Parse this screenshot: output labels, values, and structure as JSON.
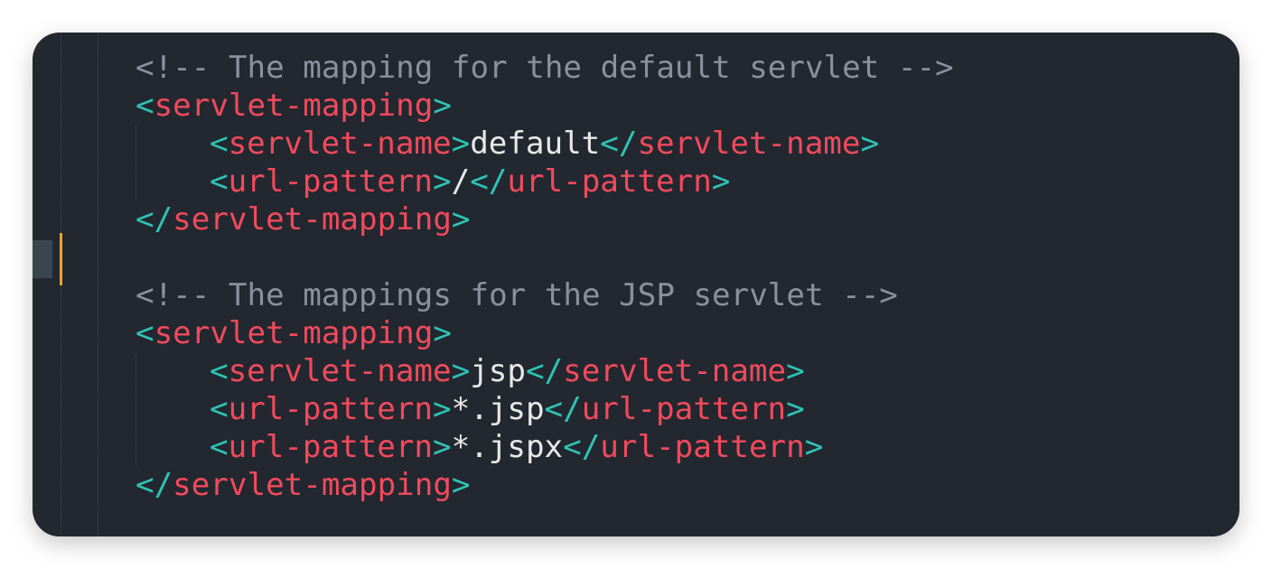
{
  "editor": {
    "colors": {
      "background": "#232830",
      "comment": "#8a919c",
      "bracket": "#2ec4b6",
      "tag": "#f24a5c",
      "text": "#e8e8e8",
      "change_marker": "#f0a030"
    },
    "lines": [
      {
        "indent": 0,
        "tokens": [
          {
            "k": "c",
            "v": "<!-- The mapping for the default servlet -->"
          }
        ]
      },
      {
        "indent": 0,
        "tokens": [
          {
            "k": "p",
            "v": "<"
          },
          {
            "k": "t",
            "v": "servlet-mapping"
          },
          {
            "k": "p",
            "v": ">"
          }
        ]
      },
      {
        "indent": 1,
        "tokens": [
          {
            "k": "p",
            "v": "<"
          },
          {
            "k": "t",
            "v": "servlet-name"
          },
          {
            "k": "p",
            "v": ">"
          },
          {
            "k": "x",
            "v": "default"
          },
          {
            "k": "p",
            "v": "</"
          },
          {
            "k": "t",
            "v": "servlet-name"
          },
          {
            "k": "p",
            "v": ">"
          }
        ]
      },
      {
        "indent": 1,
        "tokens": [
          {
            "k": "p",
            "v": "<"
          },
          {
            "k": "t",
            "v": "url-pattern"
          },
          {
            "k": "p",
            "v": ">"
          },
          {
            "k": "x",
            "v": "/"
          },
          {
            "k": "p",
            "v": "</"
          },
          {
            "k": "t",
            "v": "url-pattern"
          },
          {
            "k": "p",
            "v": ">"
          }
        ]
      },
      {
        "indent": 0,
        "tokens": [
          {
            "k": "p",
            "v": "</"
          },
          {
            "k": "t",
            "v": "servlet-mapping"
          },
          {
            "k": "p",
            "v": ">"
          }
        ]
      },
      {
        "indent": 0,
        "tokens": []
      },
      {
        "indent": 0,
        "tokens": [
          {
            "k": "c",
            "v": "<!-- The mappings for the JSP servlet -->"
          }
        ]
      },
      {
        "indent": 0,
        "tokens": [
          {
            "k": "p",
            "v": "<"
          },
          {
            "k": "t",
            "v": "servlet-mapping"
          },
          {
            "k": "p",
            "v": ">"
          }
        ]
      },
      {
        "indent": 1,
        "tokens": [
          {
            "k": "p",
            "v": "<"
          },
          {
            "k": "t",
            "v": "servlet-name"
          },
          {
            "k": "p",
            "v": ">"
          },
          {
            "k": "x",
            "v": "jsp"
          },
          {
            "k": "p",
            "v": "</"
          },
          {
            "k": "t",
            "v": "servlet-name"
          },
          {
            "k": "p",
            "v": ">"
          }
        ]
      },
      {
        "indent": 1,
        "tokens": [
          {
            "k": "p",
            "v": "<"
          },
          {
            "k": "t",
            "v": "url-pattern"
          },
          {
            "k": "p",
            "v": ">"
          },
          {
            "k": "x",
            "v": "*.jsp"
          },
          {
            "k": "p",
            "v": "</"
          },
          {
            "k": "t",
            "v": "url-pattern"
          },
          {
            "k": "p",
            "v": ">"
          }
        ]
      },
      {
        "indent": 1,
        "tokens": [
          {
            "k": "p",
            "v": "<"
          },
          {
            "k": "t",
            "v": "url-pattern"
          },
          {
            "k": "p",
            "v": ">"
          },
          {
            "k": "x",
            "v": "*.jspx"
          },
          {
            "k": "p",
            "v": "</"
          },
          {
            "k": "t",
            "v": "url-pattern"
          },
          {
            "k": "p",
            "v": ">"
          }
        ]
      },
      {
        "indent": 0,
        "tokens": [
          {
            "k": "p",
            "v": "</"
          },
          {
            "k": "t",
            "v": "servlet-mapping"
          },
          {
            "k": "p",
            "v": ">"
          }
        ]
      }
    ]
  }
}
